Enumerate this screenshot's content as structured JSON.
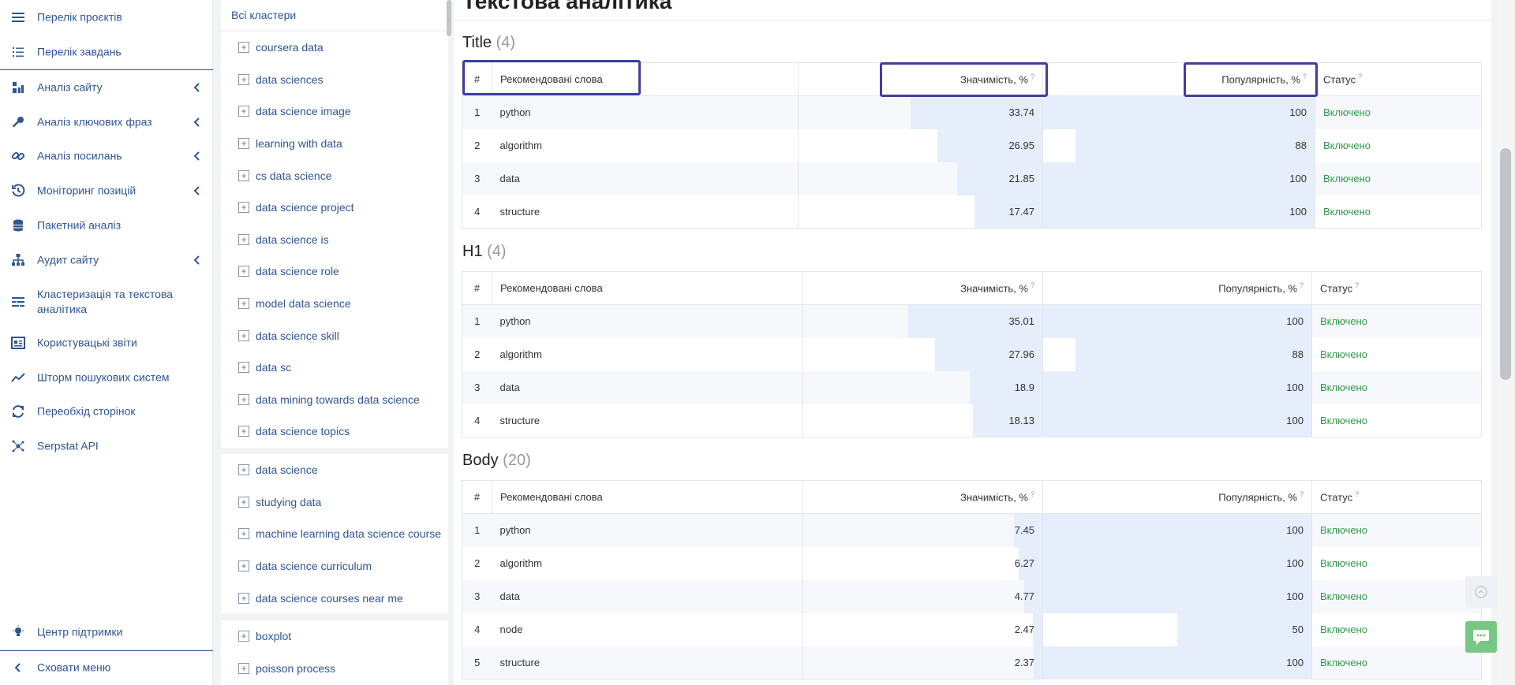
{
  "nav": {
    "items": [
      {
        "label": "Перелік проєктів",
        "icon": "menu-icon"
      },
      {
        "label": "Перелік завдань",
        "icon": "list-icon"
      },
      {
        "label": "Аналіз сайту",
        "icon": "site-analysis-icon"
      },
      {
        "label": "Аналіз ключових фраз",
        "icon": "key-icon"
      },
      {
        "label": "Аналіз посилань",
        "icon": "link-icon"
      },
      {
        "label": "Моніторинг позицій",
        "icon": "history-icon"
      },
      {
        "label": "Пакетний аналіз",
        "icon": "database-icon"
      },
      {
        "label": "Аудит сайту",
        "icon": "sitemap-icon"
      },
      {
        "label": "Кластеризація та текстова аналітика",
        "icon": "cluster-icon"
      },
      {
        "label": "Користувацькі звіти",
        "icon": "report-icon"
      },
      {
        "label": "Шторм пошукових систем",
        "icon": "trend-icon"
      },
      {
        "label": "Переобхід сторінок",
        "icon": "refresh-icon"
      },
      {
        "label": "Serpstat API",
        "icon": "api-icon"
      }
    ],
    "support": "Центр підтримки",
    "hide": "Сховати меню"
  },
  "clusters": {
    "all": "Всі кластери",
    "group1": [
      "coursera data",
      "data sciences",
      "data science image",
      "learning with data",
      "cs data science",
      "data science project",
      "data science is",
      "data science role",
      "model data science",
      "data science skill",
      "data sc",
      "data mining towards data science",
      "data science topics"
    ],
    "group2": [
      "data science",
      "studying data",
      "machine learning data science course",
      "data science curriculum",
      "data science courses near me"
    ],
    "group3": [
      "boxplot",
      "poisson process"
    ]
  },
  "page": {
    "title": "Текстова аналітика"
  },
  "headers": {
    "num": "#",
    "words": "Рекомендовані слова",
    "sig": "Значимість, %",
    "pop": "Популярність, %",
    "status": "Статус",
    "q": "?"
  },
  "sections": {
    "title": {
      "name": "Title",
      "count": "(4)",
      "rows": [
        {
          "n": "1",
          "word": "python",
          "sig": "33.74",
          "pop": "100",
          "status": "Включено"
        },
        {
          "n": "2",
          "word": "algorithm",
          "sig": "26.95",
          "pop": "88",
          "status": "Включено"
        },
        {
          "n": "3",
          "word": "data",
          "sig": "21.85",
          "pop": "100",
          "status": "Включено"
        },
        {
          "n": "4",
          "word": "structure",
          "sig": "17.47",
          "pop": "100",
          "status": "Включено"
        }
      ]
    },
    "h1": {
      "name": "H1",
      "count": "(4)",
      "rows": [
        {
          "n": "1",
          "word": "python",
          "sig": "35.01",
          "pop": "100",
          "status": "Включено"
        },
        {
          "n": "2",
          "word": "algorithm",
          "sig": "27.96",
          "pop": "88",
          "status": "Включено"
        },
        {
          "n": "3",
          "word": "data",
          "sig": "18.9",
          "pop": "100",
          "status": "Включено"
        },
        {
          "n": "4",
          "word": "structure",
          "sig": "18.13",
          "pop": "100",
          "status": "Включено"
        }
      ]
    },
    "body": {
      "name": "Body",
      "count": "(20)",
      "rows": [
        {
          "n": "1",
          "word": "python",
          "sig": "7.45",
          "pop": "100",
          "status": "Включено"
        },
        {
          "n": "2",
          "word": "algorithm",
          "sig": "6.27",
          "pop": "100",
          "status": "Включено"
        },
        {
          "n": "3",
          "word": "data",
          "sig": "4.77",
          "pop": "100",
          "status": "Включено"
        },
        {
          "n": "4",
          "word": "node",
          "sig": "2.47",
          "pop": "50",
          "status": "Включено"
        },
        {
          "n": "5",
          "word": "structure",
          "sig": "2.37",
          "pop": "100",
          "status": "Включено"
        }
      ]
    }
  },
  "colors": {
    "accent": "#2f5592",
    "status": "#2e9a47",
    "bar": "#e6edfb",
    "highlight": "#3f3f9e"
  }
}
